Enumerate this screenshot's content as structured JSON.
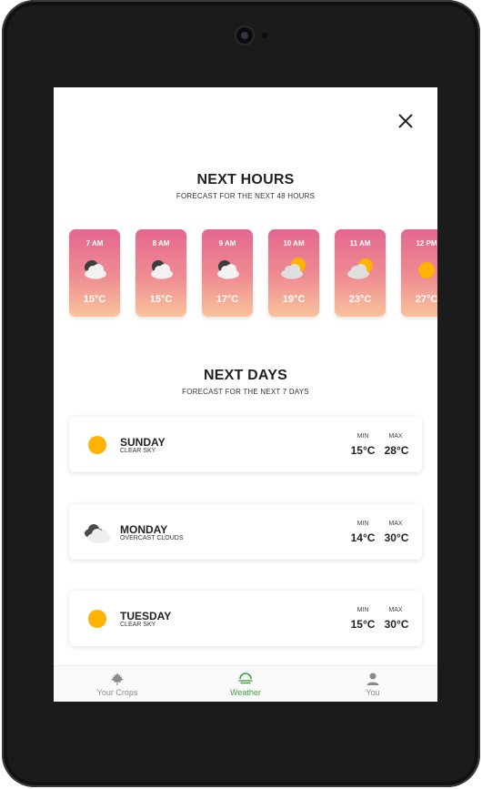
{
  "next_hours": {
    "title": "NEXT HOURS",
    "subtitle": "FORECAST FOR THE NEXT 48 HOURS",
    "items": [
      {
        "time": "7 AM",
        "temp": "15°C",
        "icon": "cloudy-night-icon"
      },
      {
        "time": "8 AM",
        "temp": "15°C",
        "icon": "cloudy-night-icon"
      },
      {
        "time": "9 AM",
        "temp": "17°C",
        "icon": "cloudy-night-icon"
      },
      {
        "time": "10 AM",
        "temp": "19°C",
        "icon": "partly-cloudy-icon"
      },
      {
        "time": "11 AM",
        "temp": "23°C",
        "icon": "partly-cloudy-icon"
      },
      {
        "time": "12 PM",
        "temp": "27°C",
        "icon": "sun-icon"
      }
    ]
  },
  "next_days": {
    "title": "NEXT DAYS",
    "subtitle": "FORECAST FOR THE NEXT 7 DAYS",
    "min_label": "MIN",
    "max_label": "MAX",
    "items": [
      {
        "day": "SUNDAY",
        "desc": "CLEAR SKY",
        "min": "15°C",
        "max": "28°C",
        "icon": "sun-icon"
      },
      {
        "day": "MONDAY",
        "desc": "OVERCAST CLOUDS",
        "min": "14°C",
        "max": "30°C",
        "icon": "overcast-clouds-icon"
      },
      {
        "day": "TUESDAY",
        "desc": "CLEAR SKY",
        "min": "15°C",
        "max": "30°C",
        "icon": "sun-icon"
      }
    ]
  },
  "bottom_nav": {
    "items": [
      {
        "label": "Your Crops",
        "icon": "maple-leaf-icon",
        "active": false
      },
      {
        "label": "Weather",
        "icon": "weather-icon",
        "active": true
      },
      {
        "label": "You",
        "icon": "person-icon",
        "active": false
      }
    ]
  },
  "colors": {
    "accent": "#43a047",
    "card_gradient_top": "#e5678f",
    "card_gradient_bottom": "#f9c39c",
    "sun": "#ffb300"
  }
}
